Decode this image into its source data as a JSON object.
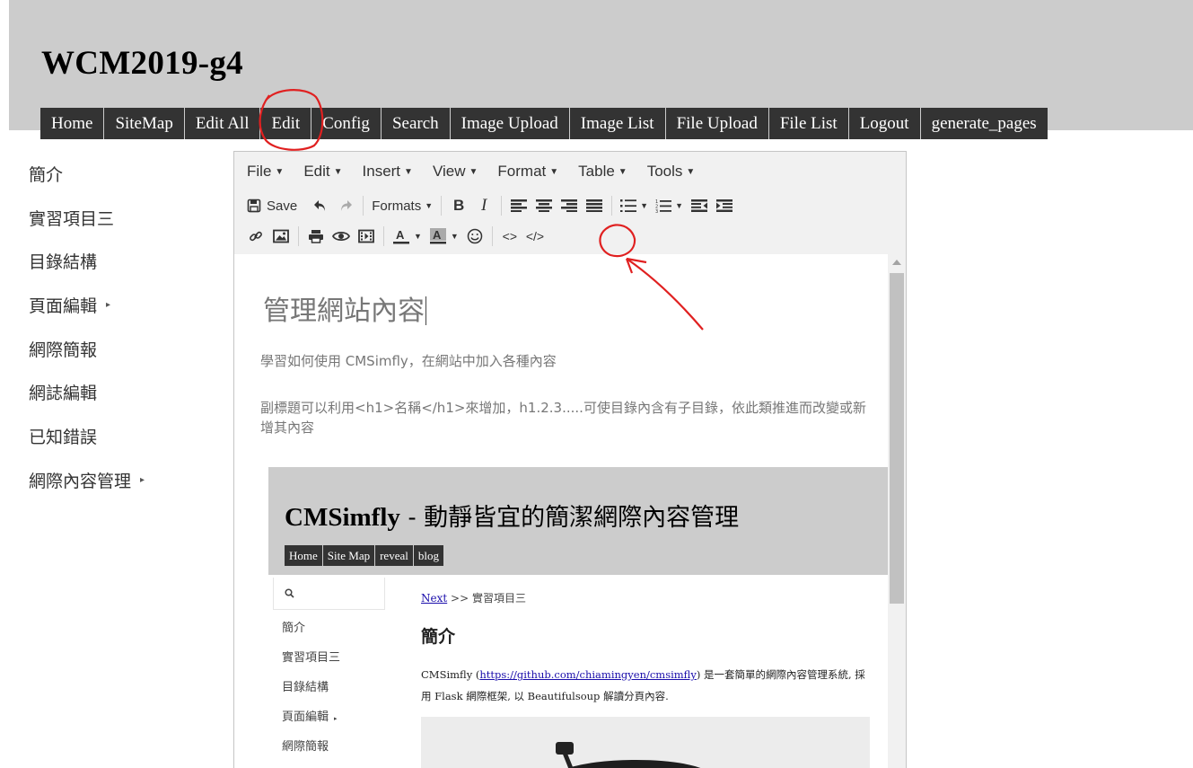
{
  "site": {
    "title": "WCM2019-g4",
    "nav": [
      "Home",
      "SiteMap",
      "Edit All",
      "Edit",
      "Config",
      "Search",
      "Image Upload",
      "Image List",
      "File Upload",
      "File List",
      "Logout",
      "generate_pages"
    ]
  },
  "sidebar": {
    "items": [
      {
        "label": "簡介",
        "arrow": ""
      },
      {
        "label": "實習項目三",
        "arrow": ""
      },
      {
        "label": "目錄結構",
        "arrow": ""
      },
      {
        "label": "頁面編輯",
        "arrow": "▸"
      },
      {
        "label": "網際簡報",
        "arrow": ""
      },
      {
        "label": "網誌編輯",
        "arrow": ""
      },
      {
        "label": "已知錯誤",
        "arrow": ""
      },
      {
        "label": "網際內容管理",
        "arrow": "▸"
      }
    ]
  },
  "editor": {
    "menubar": [
      "File",
      "Edit",
      "Insert",
      "View",
      "Format",
      "Table",
      "Tools"
    ],
    "toolbar": {
      "save_label": "Save",
      "formats_label": "Formats",
      "bold_label": "B",
      "italic_label": "I",
      "code_label": "<>",
      "source_label": "</>",
      "icons": [
        "save-icon",
        "undo-icon",
        "redo-icon",
        "bold-icon",
        "italic-icon",
        "align-left-icon",
        "align-center-icon",
        "align-right-icon",
        "align-justify-icon",
        "bullet-list-icon",
        "numbered-list-icon",
        "outdent-icon",
        "indent-icon",
        "link-icon",
        "image-icon",
        "print-icon",
        "preview-icon",
        "media-icon",
        "text-color-icon",
        "background-color-icon",
        "emoticons-icon",
        "code-icon",
        "source-code-icon"
      ]
    },
    "content": {
      "title": "管理網站內容",
      "p1": "學習如何使用 CMSimfly，在網站中加入各種內容",
      "p2": "副標題可以利用<h1>名稱</h1>來增加，h1.2.3.....可使目錄內含有子目錄，依此類推進而改變或新增其內容"
    },
    "embed": {
      "title_bold": "CMSimfly",
      "title_rest": " - 動靜皆宜的簡潔網際內容管理",
      "nav": [
        "Home",
        "Site Map",
        "reveal",
        "blog"
      ],
      "side": [
        {
          "label": "簡介",
          "arrow": ""
        },
        {
          "label": "實習項目三",
          "arrow": ""
        },
        {
          "label": "目錄結構",
          "arrow": ""
        },
        {
          "label": "頁面編輯",
          "arrow": "▸"
        },
        {
          "label": "網際簡報",
          "arrow": ""
        }
      ],
      "crumb_link": "Next",
      "crumb_rest": " >> 實習項目三",
      "heading": "簡介",
      "para_pre": "CMSimfly (",
      "para_link": "https://github.com/chiamingyen/cmsimfly",
      "para_post": ") 是一套簡單的網際內容管理系統, 採用 Flask 網際框架, 以 Beautifulsoup 解讀分頁內容."
    }
  },
  "colors": {
    "header_bg": "#cccccc",
    "nav_bg": "#333333",
    "annotation": "#e02020",
    "toolbar_bg": "#f1f1f1"
  }
}
